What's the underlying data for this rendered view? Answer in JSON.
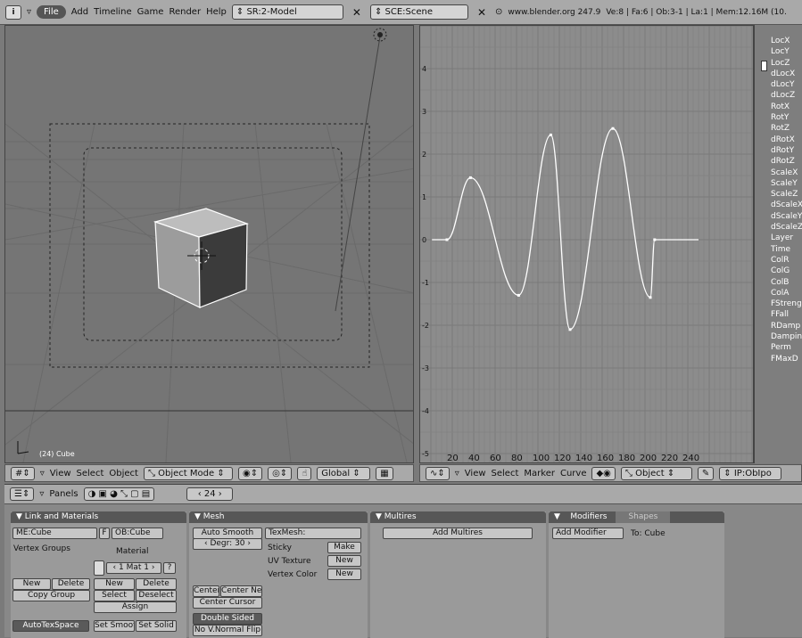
{
  "topbar": {
    "info_icon": "i",
    "file_menu": "File",
    "menus": [
      "Add",
      "Timeline",
      "Game",
      "Render",
      "Help"
    ],
    "screen_field": "SR:2-Model",
    "scene_field": "SCE:Scene",
    "url": "www.blender.org 247.9",
    "stats": "Ve:8 | Fa:6 | Ob:3-1 | La:1 | Mem:12.16M (10."
  },
  "view3d": {
    "label": "(24) Cube",
    "header": {
      "menus": [
        "View",
        "Select",
        "Object"
      ],
      "mode": "Object Mode",
      "orientation": "Global"
    }
  },
  "ipo": {
    "x_ticks": [
      "20",
      "40",
      "60",
      "80",
      "100",
      "120",
      "140",
      "160",
      "180",
      "200",
      "220",
      "240"
    ],
    "y_ticks": [
      "4",
      "3",
      "2",
      "1",
      "0",
      "-1",
      "-2",
      "-3",
      "-4",
      "-5"
    ],
    "channels": [
      "LocX",
      "LocY",
      "LocZ",
      "dLocX",
      "dLocY",
      "dLocZ",
      "RotX",
      "RotY",
      "RotZ",
      "dRotX",
      "dRotY",
      "dRotZ",
      "ScaleX",
      "ScaleY",
      "ScaleZ",
      "dScaleX",
      "dScaleY",
      "dScaleZ",
      "Layer",
      "Time",
      "ColR",
      "ColG",
      "ColB",
      "ColA",
      "FStreng",
      "FFall",
      "RDamp",
      "Dampin",
      "Perm",
      "FMaxD"
    ],
    "header": {
      "menus": [
        "View",
        "Select",
        "Marker",
        "Curve"
      ],
      "object_field": "Object",
      "ipo_field": "IP:ObIpo"
    },
    "curve_keys": [
      [
        1,
        0
      ],
      [
        15,
        0
      ],
      [
        37,
        1.45
      ],
      [
        82,
        -1.3
      ],
      [
        112,
        2.45
      ],
      [
        130,
        -2.1
      ],
      [
        170,
        2.6
      ],
      [
        205,
        -1.35
      ],
      [
        209,
        0
      ],
      [
        250,
        0
      ]
    ]
  },
  "buttons": {
    "header": {
      "panels_label": "Panels",
      "frame": "24"
    },
    "link_materials": {
      "title": "Link and Materials",
      "me_field": "ME:Cube",
      "f_label": "F",
      "ob_field": "OB:Cube",
      "vertex_groups": "Vertex Groups",
      "material": "Material",
      "mat_field": "1 Mat 1",
      "q": "?",
      "new": "New",
      "delete": "Delete",
      "copy_group": "Copy Group",
      "new2": "New",
      "delete2": "Delete",
      "select": "Select",
      "deselect": "Deselect",
      "assign": "Assign",
      "autotexspace": "AutoTexSpace",
      "set_smooth": "Set Smoot",
      "set_solid": "Set Solid"
    },
    "mesh": {
      "title": "Mesh",
      "auto_smooth": "Auto Smooth",
      "degr": "Degr: 30",
      "texmesh": "TexMesh:",
      "sticky": "Sticky",
      "make": "Make",
      "uv_texture": "UV Texture",
      "new1": "New",
      "vertex_color": "Vertex Color",
      "new2": "New",
      "center": "Center",
      "center_new": "Center Ne",
      "center_cursor": "Center Cursor",
      "double_sided": "Double Sided",
      "no_vnormal_flip": "No V.Normal Flip"
    },
    "multires": {
      "title": "Multires",
      "add_multires": "Add Multires"
    },
    "modifiers": {
      "tab_modifiers": "Modifiers",
      "tab_shapes": "Shapes",
      "add_modifier": "Add Modifier",
      "to_label": "To: Cube"
    }
  }
}
